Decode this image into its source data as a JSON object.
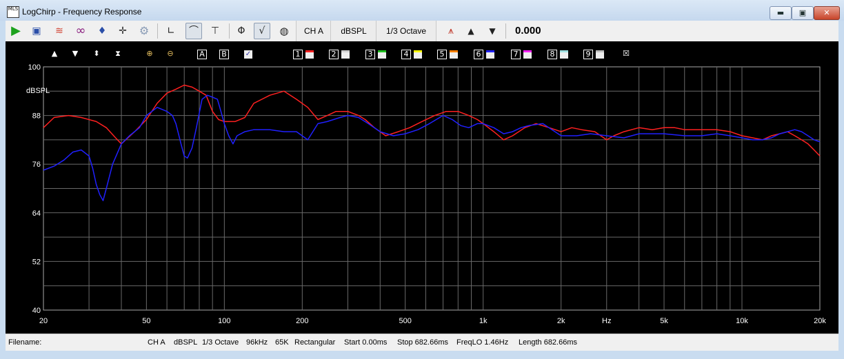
{
  "window": {
    "title": "LogChirp - Frequency Response",
    "app_icon_text": "MLS",
    "minimize_label": "▬",
    "maximize_label": "▣",
    "close_label": "✕"
  },
  "toolbar": {
    "channel": "CH A",
    "units": "dBSPL",
    "smoothing": "1/3 Octave",
    "readout": "0.000"
  },
  "plot_toolbar": {
    "labels": [
      "A",
      "B",
      "1",
      "2",
      "3",
      "4",
      "5",
      "6",
      "7",
      "8",
      "9"
    ],
    "swatch_colors": [
      "#ff2020",
      "#d0d0d0",
      "#20c020",
      "#ffff00",
      "#ff8000",
      "#2020ff",
      "#ff20ff",
      "#a0e0e0",
      "#c0c0c0"
    ]
  },
  "chart_data": {
    "type": "line",
    "ylabel": "dBSPL",
    "xlabel": "Hz",
    "x_scale": "log",
    "xlim": [
      20,
      20000
    ],
    "ylim": [
      40,
      100
    ],
    "grid": true,
    "y_ticks": [
      100,
      88,
      76,
      64,
      52,
      40
    ],
    "x_tick_labels": [
      {
        "value": 20,
        "label": "20"
      },
      {
        "value": 50,
        "label": "50"
      },
      {
        "value": 100,
        "label": "100"
      },
      {
        "value": 200,
        "label": "200"
      },
      {
        "value": 500,
        "label": "500"
      },
      {
        "value": 1000,
        "label": "1k"
      },
      {
        "value": 2000,
        "label": "2k"
      },
      {
        "value": 5000,
        "label": "5k"
      },
      {
        "value": 10000,
        "label": "10k"
      },
      {
        "value": 20000,
        "label": "20k"
      }
    ],
    "series": [
      {
        "color": "#ff2020",
        "points": [
          [
            20,
            85
          ],
          [
            22,
            87.5
          ],
          [
            25,
            88
          ],
          [
            28,
            87.5
          ],
          [
            32,
            86.5
          ],
          [
            35,
            85
          ],
          [
            38,
            82.5
          ],
          [
            40,
            81
          ],
          [
            45,
            84
          ],
          [
            50,
            87
          ],
          [
            55,
            91
          ],
          [
            60,
            93.5
          ],
          [
            65,
            94.5
          ],
          [
            70,
            95.5
          ],
          [
            75,
            95
          ],
          [
            80,
            94
          ],
          [
            85,
            93
          ],
          [
            90,
            89
          ],
          [
            95,
            87
          ],
          [
            100,
            86.5
          ],
          [
            110,
            86.5
          ],
          [
            120,
            87.5
          ],
          [
            130,
            91
          ],
          [
            150,
            93
          ],
          [
            170,
            94
          ],
          [
            190,
            92
          ],
          [
            210,
            90
          ],
          [
            230,
            87
          ],
          [
            250,
            88
          ],
          [
            270,
            89
          ],
          [
            300,
            89
          ],
          [
            330,
            88
          ],
          [
            350,
            87
          ],
          [
            380,
            85
          ],
          [
            420,
            83
          ],
          [
            470,
            84
          ],
          [
            520,
            85
          ],
          [
            580,
            86.5
          ],
          [
            650,
            88
          ],
          [
            720,
            89
          ],
          [
            800,
            89
          ],
          [
            880,
            88
          ],
          [
            950,
            87
          ],
          [
            1000,
            86
          ],
          [
            1100,
            84
          ],
          [
            1200,
            82
          ],
          [
            1300,
            83
          ],
          [
            1450,
            85
          ],
          [
            1600,
            86
          ],
          [
            1800,
            85
          ],
          [
            2000,
            84
          ],
          [
            2200,
            85
          ],
          [
            2400,
            84.5
          ],
          [
            2700,
            84
          ],
          [
            3000,
            82
          ],
          [
            3200,
            83
          ],
          [
            3500,
            84
          ],
          [
            4000,
            85
          ],
          [
            4500,
            84.5
          ],
          [
            5000,
            85
          ],
          [
            5500,
            85
          ],
          [
            6000,
            84.5
          ],
          [
            7000,
            84.5
          ],
          [
            8000,
            84.5
          ],
          [
            9000,
            84
          ],
          [
            10000,
            83
          ],
          [
            11000,
            82.5
          ],
          [
            12000,
            82
          ],
          [
            13000,
            83
          ],
          [
            14000,
            83.5
          ],
          [
            15000,
            84
          ],
          [
            16000,
            83
          ],
          [
            17000,
            82
          ],
          [
            18000,
            81
          ],
          [
            19000,
            79.5
          ],
          [
            20000,
            78
          ]
        ]
      },
      {
        "color": "#2020ff",
        "points": [
          [
            20,
            74.5
          ],
          [
            22,
            75.5
          ],
          [
            24,
            77
          ],
          [
            26,
            79
          ],
          [
            28,
            79.5
          ],
          [
            30,
            78
          ],
          [
            31,
            75
          ],
          [
            32,
            71
          ],
          [
            33,
            68.5
          ],
          [
            34,
            67
          ],
          [
            35,
            70
          ],
          [
            37,
            76
          ],
          [
            40,
            81
          ],
          [
            43,
            83
          ],
          [
            47,
            85
          ],
          [
            50,
            88
          ],
          [
            55,
            90
          ],
          [
            60,
            89
          ],
          [
            63,
            88
          ],
          [
            65,
            86
          ],
          [
            68,
            81
          ],
          [
            70,
            78
          ],
          [
            72,
            77.5
          ],
          [
            75,
            80
          ],
          [
            78,
            85
          ],
          [
            82,
            92
          ],
          [
            86,
            93
          ],
          [
            90,
            92.5
          ],
          [
            94,
            92
          ],
          [
            97,
            89
          ],
          [
            100,
            86
          ],
          [
            104,
            83
          ],
          [
            108,
            81
          ],
          [
            112,
            83
          ],
          [
            120,
            84
          ],
          [
            130,
            84.5
          ],
          [
            150,
            84.5
          ],
          [
            170,
            84
          ],
          [
            190,
            84
          ],
          [
            210,
            82
          ],
          [
            230,
            86
          ],
          [
            250,
            86.5
          ],
          [
            280,
            87.5
          ],
          [
            300,
            88
          ],
          [
            330,
            87.5
          ],
          [
            360,
            86
          ],
          [
            400,
            84
          ],
          [
            450,
            83
          ],
          [
            500,
            83.5
          ],
          [
            560,
            84.5
          ],
          [
            620,
            86
          ],
          [
            700,
            88
          ],
          [
            760,
            87
          ],
          [
            820,
            85.5
          ],
          [
            880,
            85
          ],
          [
            950,
            86
          ],
          [
            1000,
            86
          ],
          [
            1100,
            85
          ],
          [
            1200,
            83.5
          ],
          [
            1300,
            84
          ],
          [
            1400,
            85
          ],
          [
            1500,
            85.5
          ],
          [
            1700,
            86
          ],
          [
            2000,
            83
          ],
          [
            2300,
            83
          ],
          [
            2600,
            83.5
          ],
          [
            3000,
            83
          ],
          [
            3500,
            82.5
          ],
          [
            4000,
            83.5
          ],
          [
            4500,
            83.5
          ],
          [
            5000,
            83.5
          ],
          [
            6000,
            83
          ],
          [
            7000,
            83
          ],
          [
            8000,
            83.5
          ],
          [
            9000,
            83
          ],
          [
            10000,
            82.5
          ],
          [
            11000,
            82
          ],
          [
            12000,
            82
          ],
          [
            13000,
            82.5
          ],
          [
            14000,
            83.5
          ],
          [
            15000,
            84
          ],
          [
            16000,
            84.5
          ],
          [
            17000,
            84
          ],
          [
            18000,
            83
          ],
          [
            19000,
            82
          ],
          [
            20000,
            81.5
          ]
        ]
      }
    ]
  },
  "status": {
    "filename_label": "Filename:",
    "channel": "CH A",
    "units": "dBSPL",
    "smoothing": "1/3 Octave",
    "sample_rate": "96kHz",
    "length_samples": "65K",
    "window": "Rectangular",
    "start": "Start 0.00ms",
    "stop": "Stop 682.66ms",
    "freqlo": "FreqLO 1.46Hz",
    "length": "Length 682.66ms"
  }
}
